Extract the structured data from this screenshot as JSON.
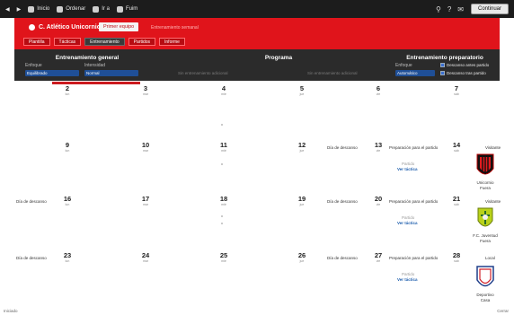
{
  "menubar": {
    "items": [
      "Inicio",
      "Ordenar",
      "Ir a",
      "Fuim"
    ],
    "continue_label": "Continuar"
  },
  "header": {
    "title": "C. Atlético Unicornio",
    "active_tab": "Primer equipo",
    "subtitle": "Entrenamiento semanal",
    "subtabs": [
      "Plantilla",
      "Tácticas",
      "Entrenamiento",
      "Partidos",
      "Informe"
    ]
  },
  "panels": {
    "general": {
      "title": "Entrenamiento general",
      "label_left": "Enfoque",
      "label_right": "Intensidad",
      "value_left": "Equilibrado",
      "value_right": "Normal"
    },
    "program": {
      "title": "Programa",
      "hint_left": "Sin entrenamiento adicional",
      "hint_right": "Sin entrenamiento adicional"
    },
    "match_prep": {
      "title": "Entrenamiento preparatorio",
      "label": "Enfoque",
      "value": "Automático",
      "check1": "Descanso antes partido",
      "check2": "Descanso tras partido"
    }
  },
  "calendar": {
    "row1": [
      {
        "n": "2",
        "d": "lun"
      },
      {
        "n": "3",
        "d": "mar"
      },
      {
        "n": "4",
        "d": "mié"
      },
      {
        "n": "5",
        "d": "jue"
      },
      {
        "n": "6",
        "d": "vie"
      },
      {
        "n": "7",
        "d": "sáb"
      }
    ],
    "row2": [
      {
        "n": "9",
        "d": "lun"
      },
      {
        "n": "10",
        "d": "mar"
      },
      {
        "n": "11",
        "d": "mié"
      },
      {
        "n": "12",
        "d": "jue"
      },
      {
        "n": "13",
        "d": "vie"
      },
      {
        "n": "14",
        "d": "sáb"
      }
    ],
    "row3": [
      {
        "n": "16",
        "d": "lun"
      },
      {
        "n": "17",
        "d": "mar"
      },
      {
        "n": "18",
        "d": "mié"
      },
      {
        "n": "19",
        "d": "jue"
      },
      {
        "n": "20",
        "d": "vie"
      },
      {
        "n": "21",
        "d": "sáb"
      }
    ],
    "row4": [
      {
        "n": "23",
        "d": "lun"
      },
      {
        "n": "24",
        "d": "mar"
      },
      {
        "n": "25",
        "d": "mié"
      },
      {
        "n": "26",
        "d": "jue"
      },
      {
        "n": "27",
        "d": "vie"
      },
      {
        "n": "28",
        "d": "sáb"
      }
    ],
    "events": {
      "rest": "Día de descanso",
      "prep": "Preparación para el partido",
      "friendly": "Partido",
      "view": "Ver táctica",
      "home": "Local",
      "away": "Visitante"
    },
    "opponents": [
      {
        "name": "Unicornio",
        "place": "Fuera"
      },
      {
        "name": "F.C. Juventud",
        "place": "Fuera"
      },
      {
        "name": "Deportivo",
        "place": "Casa"
      }
    ]
  },
  "colors": {
    "brand_red": "#e0141b",
    "dark": "#2b2b2b",
    "link_blue": "#1f5fae"
  },
  "status": {
    "left": "Iniciado",
    "right": "Cerrar"
  }
}
